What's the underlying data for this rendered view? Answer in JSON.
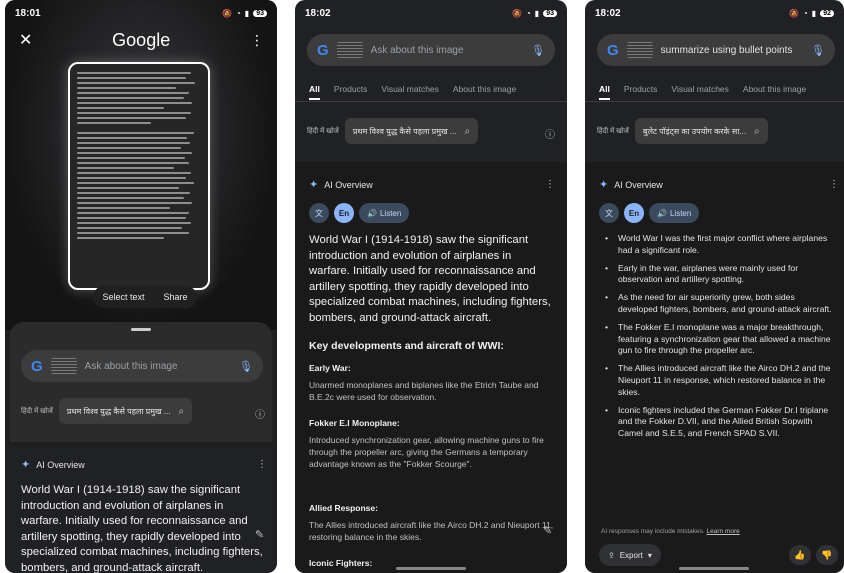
{
  "phone1": {
    "time": "18:01",
    "battery": "93",
    "title": "Google",
    "select_text": "Select text",
    "share": "Share",
    "search_placeholder": "Ask about this image",
    "lang_label": "हिंदी में खोजें",
    "chip_text": "प्रथम विश्व युद्ध कैसे पहला प्रमुख ...",
    "ai_overview": "AI Overview",
    "overview_text": "World War I (1914-1918) saw the significant introduction and evolution of airplanes in warfare. Initially used for reconnaissance and artillery spotting, they rapidly developed into specialized combat machines, including fighters, bombers, and ground-attack aircraft."
  },
  "phone2": {
    "time": "18:02",
    "battery": "93",
    "search_placeholder": "Ask about this image",
    "tabs": [
      "All",
      "Products",
      "Visual matches",
      "About this image"
    ],
    "lang_label": "हिंदी में खोजें",
    "chip_text": "प्रथम विश्व युद्ध कैसे पहला प्रमुख ...",
    "ai_overview": "AI Overview",
    "pill_en": "En",
    "listen": "Listen",
    "overview_text": "World War I (1914-1918) saw the significant introduction and evolution of airplanes in warfare. Initially used for reconnaissance and artillery spotting, they rapidly developed into specialized combat machines, including fighters, bombers, and ground-attack aircraft.",
    "key_heading": "Key developments and aircraft of WWI:",
    "sections": [
      {
        "title": "Early War:",
        "text": "Unarmed monoplanes and biplanes like the Etrich Taube and B.E.2c were used for observation."
      },
      {
        "title": "Fokker E.I Monoplane:",
        "text": "Introduced synchronization gear, allowing machine guns to fire through the propeller arc, giving the Germans a temporary advantage known as the \"Fokker Scourge\"."
      },
      {
        "title": "Allied Response:",
        "text": "The Allies introduced aircraft like the Airco DH.2 and Nieuport 11, restoring balance in the skies."
      },
      {
        "title": "Iconic Fighters:",
        "text": ""
      }
    ]
  },
  "phone3": {
    "time": "18:02",
    "battery": "92",
    "search_text": "summarize using bullet points",
    "tabs": [
      "All",
      "Products",
      "Visual matches",
      "About this image"
    ],
    "lang_label": "हिंदी में खोजें",
    "chip_text": "बुलेट पॉइंट्स का उपयोग करके सा...",
    "ai_overview": "AI Overview",
    "pill_en": "En",
    "listen": "Listen",
    "bullets": [
      "World War I was the first major conflict where airplanes had a significant role.",
      "Early in the war, airplanes were mainly used for observation and artillery spotting.",
      "As the need for air superiority grew, both sides developed fighters, bombers, and ground-attack aircraft.",
      "The Fokker E.I monoplane was a major breakthrough, featuring a synchronization gear that allowed a machine gun to fire through the propeller arc.",
      "The Allies introduced aircraft like the Airco DH.2 and the Nieuport 11 in response, which restored balance in the skies.",
      "Iconic fighters included the German Fokker Dr.I triplane and the Fokker D.VII, and the Allied British Sopwith Camel and S.E.5, and French SPAD S.VII."
    ],
    "disclaimer": "AI responses may include mistakes.",
    "learn_more": "Learn more",
    "export": "Export"
  }
}
